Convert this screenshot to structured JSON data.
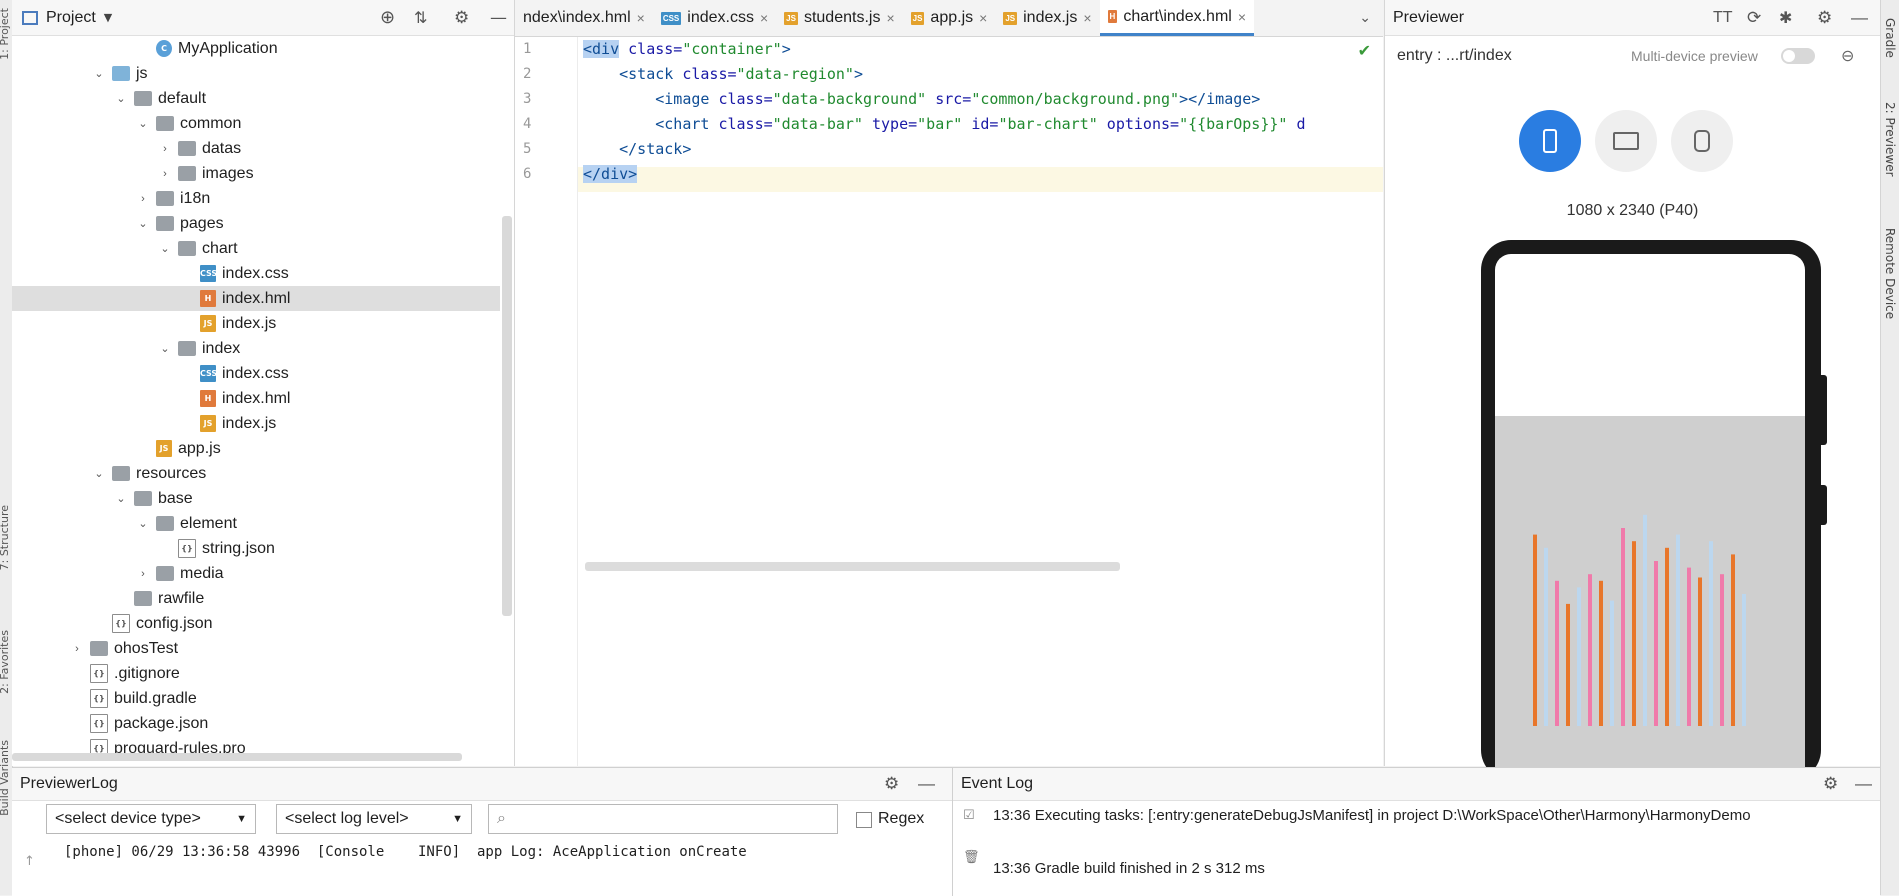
{
  "left_rail": {
    "project_tab": "1: Project",
    "structure_tab": "7: Structure",
    "favorites_tab": "2: Favorites",
    "variants_tab": "Build Variants"
  },
  "project": {
    "title": "Project",
    "tree": [
      {
        "label": "MyApplication",
        "kind": "app",
        "depth": 6,
        "chev": ""
      },
      {
        "label": "js",
        "kind": "folder-blue",
        "depth": 4,
        "chev": "v"
      },
      {
        "label": "default",
        "kind": "folder",
        "depth": 5,
        "chev": "v"
      },
      {
        "label": "common",
        "kind": "folder",
        "depth": 6,
        "chev": "v"
      },
      {
        "label": "datas",
        "kind": "folder",
        "depth": 7,
        "chev": ">"
      },
      {
        "label": "images",
        "kind": "folder",
        "depth": 7,
        "chev": ">"
      },
      {
        "label": "i18n",
        "kind": "folder",
        "depth": 6,
        "chev": ">"
      },
      {
        "label": "pages",
        "kind": "folder",
        "depth": 6,
        "chev": "v"
      },
      {
        "label": "chart",
        "kind": "folder",
        "depth": 7,
        "chev": "v"
      },
      {
        "label": "index.css",
        "kind": "css",
        "depth": 8,
        "chev": ""
      },
      {
        "label": "index.hml",
        "kind": "hml",
        "depth": 8,
        "chev": "",
        "selected": true
      },
      {
        "label": "index.js",
        "kind": "js",
        "depth": 8,
        "chev": ""
      },
      {
        "label": "index",
        "kind": "folder",
        "depth": 7,
        "chev": "v"
      },
      {
        "label": "index.css",
        "kind": "css",
        "depth": 8,
        "chev": ""
      },
      {
        "label": "index.hml",
        "kind": "hml",
        "depth": 8,
        "chev": ""
      },
      {
        "label": "index.js",
        "kind": "js",
        "depth": 8,
        "chev": ""
      },
      {
        "label": "app.js",
        "kind": "js",
        "depth": 6,
        "chev": ""
      },
      {
        "label": "resources",
        "kind": "folder",
        "depth": 4,
        "chev": "v"
      },
      {
        "label": "base",
        "kind": "folder",
        "depth": 5,
        "chev": "v"
      },
      {
        "label": "element",
        "kind": "folder",
        "depth": 6,
        "chev": "v"
      },
      {
        "label": "string.json",
        "kind": "json",
        "depth": 7,
        "chev": ""
      },
      {
        "label": "media",
        "kind": "folder",
        "depth": 6,
        "chev": ">"
      },
      {
        "label": "rawfile",
        "kind": "folder",
        "depth": 5,
        "chev": ""
      },
      {
        "label": "config.json",
        "kind": "json",
        "depth": 4,
        "chev": ""
      },
      {
        "label": "ohosTest",
        "kind": "folder",
        "depth": 3,
        "chev": ">"
      },
      {
        "label": ".gitignore",
        "kind": "json",
        "depth": 3,
        "chev": ""
      },
      {
        "label": "build.gradle",
        "kind": "json",
        "depth": 3,
        "chev": ""
      },
      {
        "label": "package.json",
        "kind": "json",
        "depth": 3,
        "chev": ""
      },
      {
        "label": "proguard-rules.pro",
        "kind": "json",
        "depth": 3,
        "chev": ""
      }
    ]
  },
  "editor": {
    "tabs": [
      {
        "label": "ndex\\index.hml",
        "icon": "",
        "active": false
      },
      {
        "label": "index.css",
        "icon": "CSS",
        "active": false
      },
      {
        "label": "students.js",
        "icon": "JS",
        "active": false
      },
      {
        "label": "app.js",
        "icon": "JS",
        "active": false
      },
      {
        "label": "index.js",
        "icon": "JS",
        "active": false
      },
      {
        "label": "chart\\index.hml",
        "icon": "H",
        "active": true
      }
    ],
    "line_numbers": [
      "1",
      "2",
      "3",
      "4",
      "5",
      "6"
    ],
    "lines": [
      [
        [
          "sel tag",
          "<div"
        ],
        [
          "attr",
          " class="
        ],
        [
          "str",
          "\"container\""
        ],
        [
          "tag",
          ">"
        ]
      ],
      [
        [
          "",
          "    "
        ],
        [
          "tag",
          "<stack"
        ],
        [
          "attr",
          " class="
        ],
        [
          "str",
          "\"data-region\""
        ],
        [
          "tag",
          ">"
        ]
      ],
      [
        [
          "",
          "        "
        ],
        [
          "tag",
          "<image"
        ],
        [
          "attr",
          " class="
        ],
        [
          "str",
          "\"data-background\""
        ],
        [
          "attr",
          " src="
        ],
        [
          "str",
          "\"common/background.png\""
        ],
        [
          "tag",
          "></image>"
        ]
      ],
      [
        [
          "",
          "        "
        ],
        [
          "tag",
          "<chart"
        ],
        [
          "attr",
          " class="
        ],
        [
          "str",
          "\"data-bar\""
        ],
        [
          "attr",
          " type="
        ],
        [
          "str",
          "\"bar\""
        ],
        [
          "attr",
          " id="
        ],
        [
          "str",
          "\"bar-chart\""
        ],
        [
          "attr",
          " options="
        ],
        [
          "str",
          "\"{{barOps}}\""
        ],
        [
          "attr",
          " d"
        ]
      ],
      [
        [
          "",
          "    "
        ],
        [
          "tag",
          "</stack>"
        ]
      ],
      [
        [
          "sel tag",
          "</div>"
        ]
      ]
    ]
  },
  "previewer": {
    "title": "Previewer",
    "entry": "entry : ...rt/index",
    "multi_device": "Multi-device preview",
    "resolution": "1080 x 2340 (P40)"
  },
  "right_rail": {
    "gradle": "Gradle",
    "previewer": "2: Previewer",
    "remote": "Remote Device"
  },
  "previewer_log": {
    "title": "PreviewerLog",
    "device_select": "<select device type>",
    "level_select": "<select log level>",
    "regex_label": "Regex",
    "log_line": "[phone] 06/29 13:36:58 43996  [Console    INFO]  app Log: AceApplication onCreate"
  },
  "event_log": {
    "title": "Event Log",
    "entries": [
      "13:36  Executing tasks: [:entry:generateDebugJsManifest] in project D:\\WorkSpace\\Other\\Harmony\\HarmonyDemo",
      "13:36  Gradle build finished in 2 s 312 ms"
    ]
  },
  "colors": {
    "accent": "#2a7de1",
    "bar_orange": "#e8762a",
    "bar_pink": "#f07aaa",
    "bar_lightblue": "#bcd7ef"
  }
}
